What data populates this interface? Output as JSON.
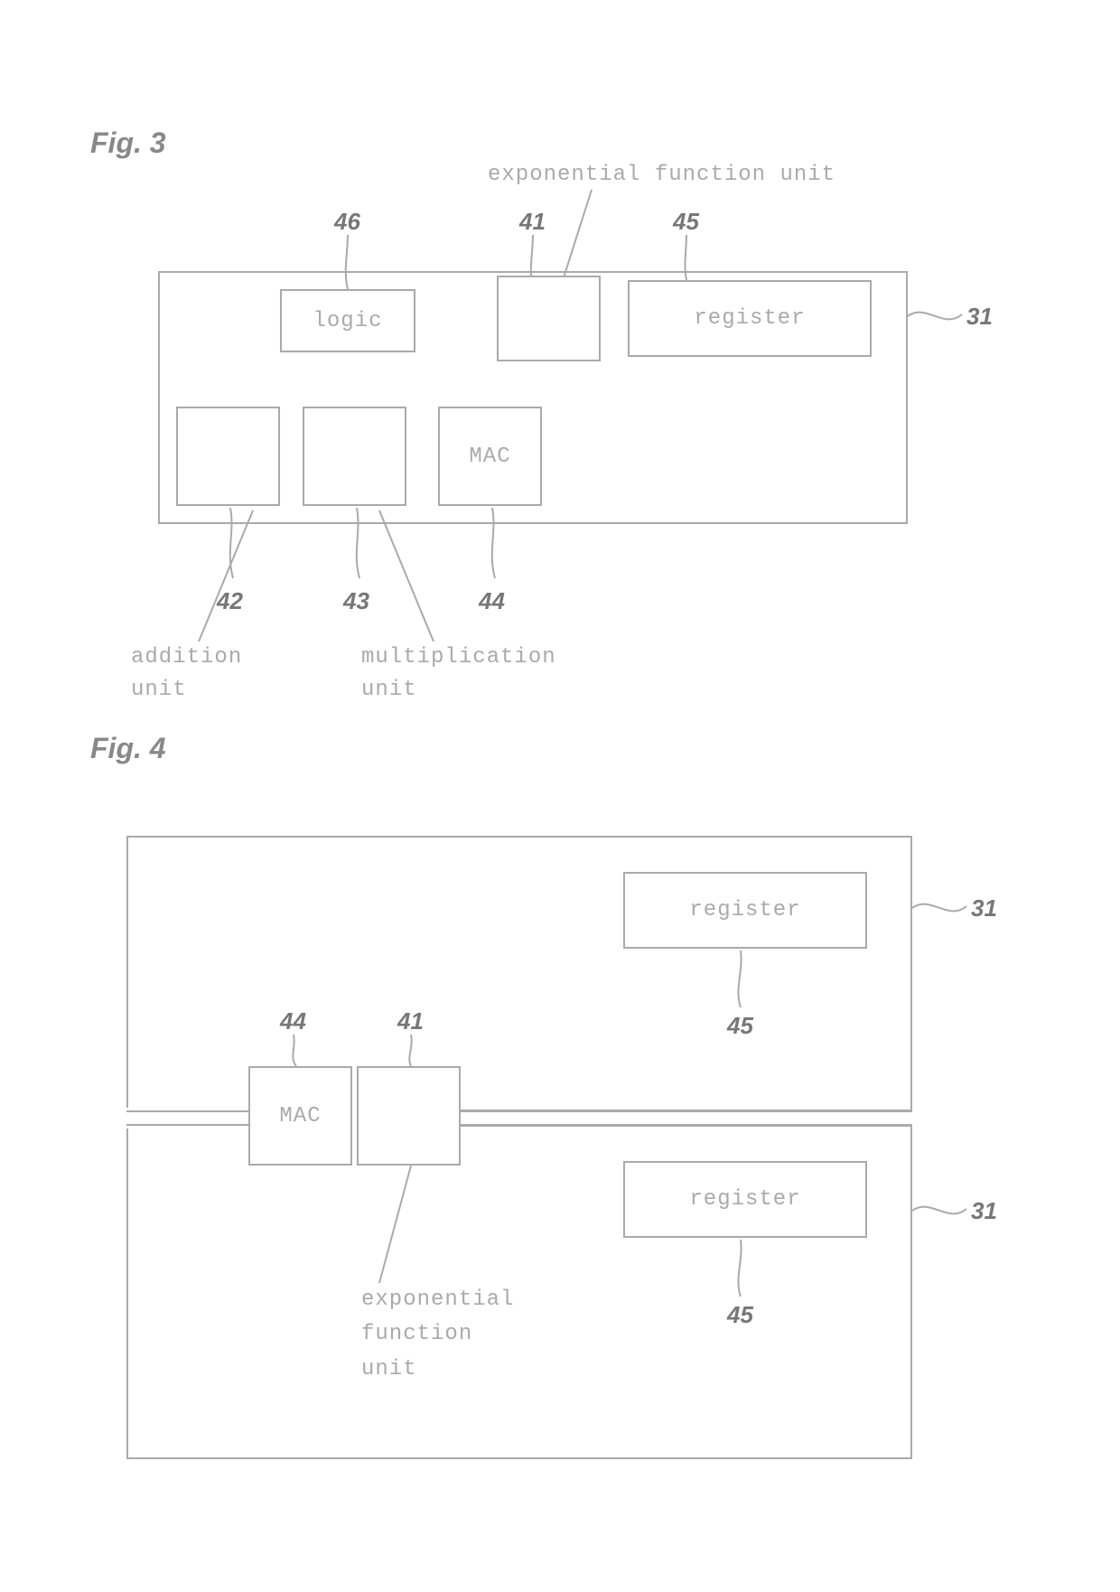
{
  "fig3": {
    "title": "Fig. 3",
    "callout_41": "exponential function unit",
    "refs": {
      "r46": "46",
      "r41": "41",
      "r45": "45",
      "r31": "31",
      "r42": "42",
      "r43": "43",
      "r44": "44"
    },
    "boxes": {
      "logic": "logic",
      "register": "register",
      "mac": "MAC"
    },
    "label42": "addition unit",
    "label43": "multiplication unit"
  },
  "fig4": {
    "title": "Fig. 4",
    "refs": {
      "r31a": "31",
      "r31b": "31",
      "r44": "44",
      "r41": "41",
      "r45a": "45",
      "r45b": "45"
    },
    "boxes": {
      "register_a": "register",
      "register_b": "register",
      "mac": "MAC"
    },
    "label41": "exponential function unit"
  }
}
